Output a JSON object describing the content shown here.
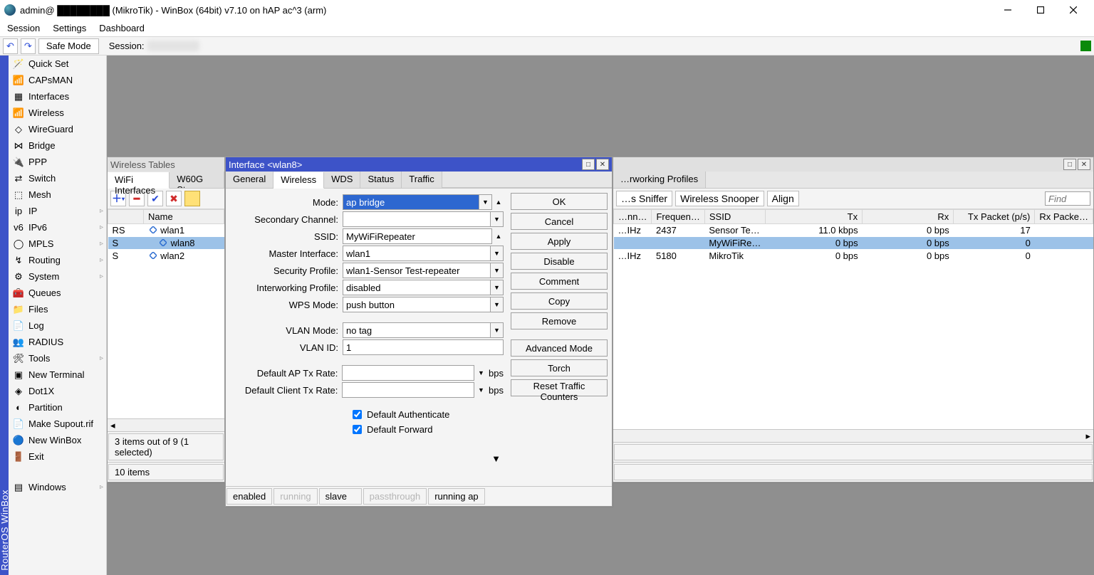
{
  "titlebar": {
    "text": "admin@ ████████ (MikroTik) - WinBox (64bit) v7.10 on hAP ac^3 (arm)"
  },
  "menubar": [
    "Session",
    "Settings",
    "Dashboard"
  ],
  "toolbar": {
    "safe_mode": "Safe Mode",
    "session_label": "Session:"
  },
  "sidebar": [
    {
      "label": "Quick Set",
      "icon": "🪄",
      "sub": false
    },
    {
      "label": "CAPsMAN",
      "icon": "📶",
      "sub": false
    },
    {
      "label": "Interfaces",
      "icon": "▦",
      "sub": false
    },
    {
      "label": "Wireless",
      "icon": "📶",
      "sub": false
    },
    {
      "label": "WireGuard",
      "icon": "◇",
      "sub": false
    },
    {
      "label": "Bridge",
      "icon": "⋈",
      "sub": false
    },
    {
      "label": "PPP",
      "icon": "🔌",
      "sub": false
    },
    {
      "label": "Switch",
      "icon": "⇄",
      "sub": false
    },
    {
      "label": "Mesh",
      "icon": "⬚",
      "sub": false
    },
    {
      "label": "IP",
      "icon": "ip",
      "sub": true
    },
    {
      "label": "IPv6",
      "icon": "v6",
      "sub": true
    },
    {
      "label": "MPLS",
      "icon": "◯",
      "sub": true
    },
    {
      "label": "Routing",
      "icon": "↯",
      "sub": true
    },
    {
      "label": "System",
      "icon": "⚙",
      "sub": true
    },
    {
      "label": "Queues",
      "icon": "🧰",
      "sub": false
    },
    {
      "label": "Files",
      "icon": "📁",
      "sub": false
    },
    {
      "label": "Log",
      "icon": "📄",
      "sub": false
    },
    {
      "label": "RADIUS",
      "icon": "👥",
      "sub": false
    },
    {
      "label": "Tools",
      "icon": "🛠",
      "sub": true
    },
    {
      "label": "New Terminal",
      "icon": "▣",
      "sub": false
    },
    {
      "label": "Dot1X",
      "icon": "◈",
      "sub": false
    },
    {
      "label": "Partition",
      "icon": "◐",
      "sub": false
    },
    {
      "label": "Make Supout.rif",
      "icon": "📄",
      "sub": false
    },
    {
      "label": "New WinBox",
      "icon": "🔵",
      "sub": false
    },
    {
      "label": "Exit",
      "icon": "🚪",
      "sub": false
    },
    {
      "label": "Windows",
      "icon": "▤",
      "sub": true,
      "spaced": true
    }
  ],
  "wireless_tables": {
    "title": "Wireless Tables",
    "tabs": [
      "WiFi Interfaces",
      "W60G Sta…",
      "…rworking Profiles"
    ],
    "toolbar2": [
      "…s Sniffer",
      "Wireless Snooper",
      "Align"
    ],
    "find_placeholder": "Find",
    "cols_left": [
      "",
      "Name"
    ],
    "rows_left": [
      {
        "flag": "RS",
        "name": "wlan1",
        "virtual": false
      },
      {
        "flag": "S",
        "name": "wlan8",
        "virtual": true,
        "sel": true
      },
      {
        "flag": "S",
        "name": "wlan2",
        "virtual": false
      }
    ],
    "cols_right": [
      "…nn…",
      "Frequen…",
      "SSID",
      "Tx",
      "Rx",
      "Tx Packet (p/s)",
      "Rx Packe…"
    ],
    "rows_right": [
      {
        "vals": [
          "…IHz",
          "2437",
          "Sensor Te…",
          "11.0 kbps",
          "0 bps",
          "17",
          ""
        ]
      },
      {
        "sel": true,
        "vals": [
          "",
          "",
          "MyWiFiRe…",
          "0 bps",
          "0 bps",
          "0",
          ""
        ]
      },
      {
        "vals": [
          "…IHz",
          "5180",
          "MikroTik",
          "0 bps",
          "0 bps",
          "0",
          ""
        ]
      }
    ],
    "status_left": "3 items out of 9 (1 selected)",
    "status_right": "10 items"
  },
  "interface_dialog": {
    "title": "Interface <wlan8>",
    "tabs": [
      "General",
      "Wireless",
      "WDS",
      "Status",
      "Traffic"
    ],
    "fields": {
      "mode_label": "Mode:",
      "mode": "ap bridge",
      "sec_label": "Secondary Channel:",
      "sec": "",
      "ssid_label": "SSID:",
      "ssid": "MyWiFiRepeater",
      "master_label": "Master Interface:",
      "master": "wlan1",
      "sp_label": "Security Profile:",
      "sp": "wlan1-Sensor Test-repeater",
      "iw_label": "Interworking Profile:",
      "iw": "disabled",
      "wps_label": "WPS Mode:",
      "wps": "push button",
      "vmode_label": "VLAN Mode:",
      "vmode": "no tag",
      "vid_label": "VLAN ID:",
      "vid": "1",
      "apr_label": "Default AP Tx Rate:",
      "apr": "",
      "bps": "bps",
      "clr_label": "Default Client Tx Rate:",
      "clr": "",
      "auth_label": "Default Authenticate",
      "fwd_label": "Default Forward"
    },
    "buttons": [
      "OK",
      "Cancel",
      "Apply",
      "Disable",
      "Comment",
      "Copy",
      "Remove",
      "Advanced Mode",
      "Torch",
      "Reset Traffic Counters"
    ],
    "status": {
      "enabled": "enabled",
      "running": "running",
      "slave": "slave",
      "pass": "passthrough",
      "runap": "running ap"
    }
  },
  "leftbar": "RouterOS  WinBox"
}
